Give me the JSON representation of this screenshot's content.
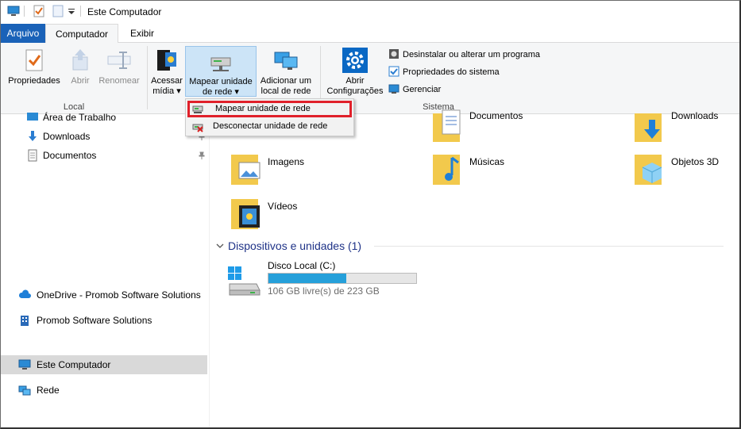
{
  "window": {
    "title": "Este Computador"
  },
  "tabs": {
    "file": "Arquivo",
    "computer": "Computador",
    "view": "Exibir"
  },
  "ribbon": {
    "local": {
      "label": "Local",
      "properties": "Propriedades",
      "open": "Abrir",
      "rename": "Renomear"
    },
    "network": {
      "access_media_1": "Acessar",
      "access_media_2": "mídia",
      "map_drive_1": "Mapear unidade",
      "map_drive_2": "de rede",
      "add_location_1": "Adicionar um",
      "add_location_2": "local de rede"
    },
    "system": {
      "label": "Sistema",
      "open_settings_1": "Abrir",
      "open_settings_2": "Configurações",
      "uninstall": "Desinstalar ou alterar um programa",
      "system_properties": "Propriedades do sistema",
      "manage": "Gerenciar"
    }
  },
  "dropdown": {
    "map_drive": "Mapear unidade de rede",
    "disconnect_drive": "Desconectar unidade de rede"
  },
  "nav": {
    "desktop": "Área de Trabalho",
    "downloads": "Downloads",
    "documents": "Documentos",
    "onedrive": "OneDrive - Promob Software Solutions",
    "promob": "Promob Software Solutions",
    "this_pc": "Este Computador",
    "network": "Rede"
  },
  "folders": {
    "documents": "Documentos",
    "downloads": "Downloads",
    "images": "Imagens",
    "music": "Músicas",
    "objects3d": "Objetos 3D",
    "videos": "Vídeos"
  },
  "devices": {
    "heading": "Dispositivos e unidades (1)",
    "drive_name": "Disco Local (C:)",
    "drive_space": "106 GB livre(s) de 223 GB",
    "drive_used_fraction": 0.525
  },
  "colors": {
    "accent": "#1a62b8",
    "selection": "#cce4f7",
    "highlight_box": "#e0202a",
    "drive_fill": "#26a0da"
  }
}
